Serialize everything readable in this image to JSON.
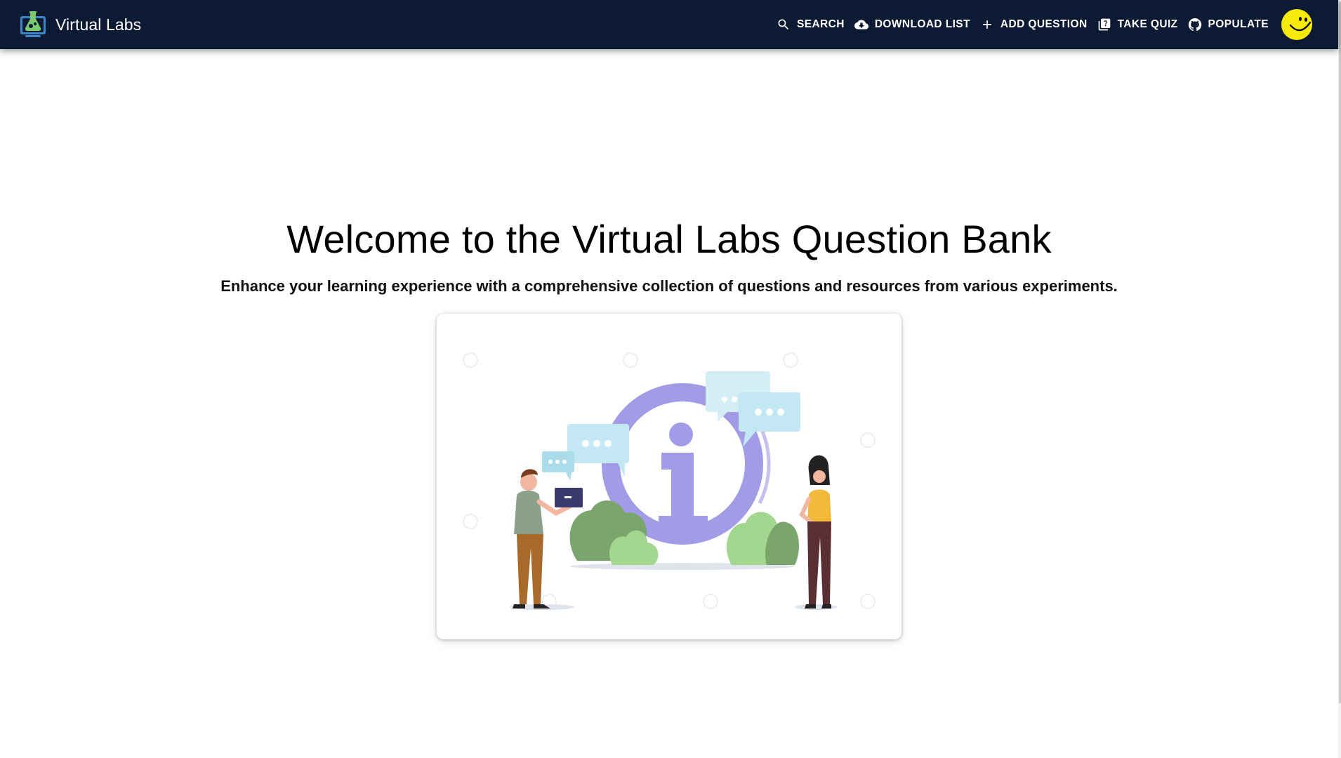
{
  "app": {
    "title": "Virtual Labs"
  },
  "nav": {
    "search": "SEARCH",
    "download_list": "DOWNLOAD LIST",
    "add_question": "ADD QUESTION",
    "take_quiz": "TAKE QUIZ",
    "populate": "POPULATE"
  },
  "icons": {
    "logo": "virtual-labs-flask-logo",
    "search": "search-icon",
    "download": "cloud-download-icon",
    "add": "plus-icon",
    "quiz": "quiz-icon",
    "github": "github-icon",
    "avatar": "smiley-avatar"
  },
  "hero": {
    "title": "Welcome to the Virtual Labs Question Bank",
    "subtitle": "Enhance your learning experience with a comprehensive collection of questions and resources from various experiments."
  },
  "colors": {
    "appbar": "#0d1a33",
    "accent_purple": "#a29be6",
    "bubble": "#c9ecf4",
    "leaf": "#9bd28a",
    "avatar": "#f5e90e"
  }
}
